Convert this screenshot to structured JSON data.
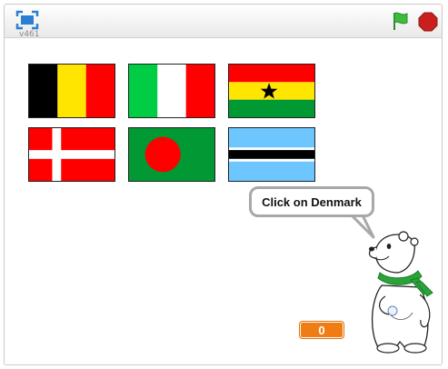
{
  "player": {
    "version": "v461",
    "fullscreen_icon": "fullscreen-icon",
    "green_flag_icon": "green-flag-icon",
    "stop_icon": "stop-sign-icon"
  },
  "stage": {
    "prompt": "Click on Denmark",
    "score": "0",
    "character": "polar-bear-with-green-scarf"
  },
  "flags": [
    {
      "country": "belgium"
    },
    {
      "country": "italy"
    },
    {
      "country": "ghana"
    },
    {
      "country": "denmark"
    },
    {
      "country": "bangladesh"
    },
    {
      "country": "botswana"
    }
  ],
  "colors": {
    "green_flag": "#3cbb3c",
    "stop": "#c9201e",
    "counter": "#f07d14",
    "fullscreen": "#2b7fd2"
  }
}
